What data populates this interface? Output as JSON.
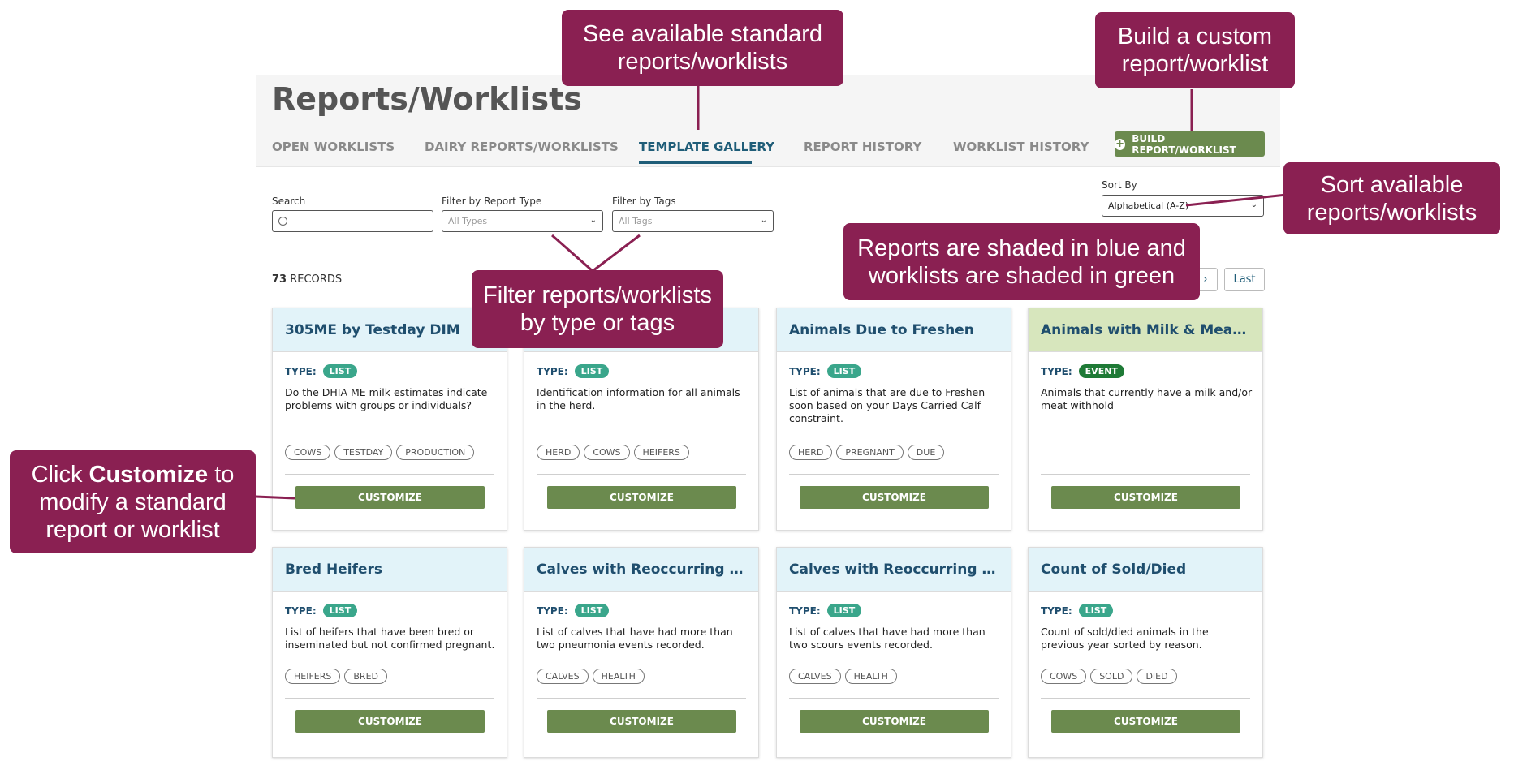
{
  "page_title": "Reports/Worklists",
  "tabs": [
    {
      "label": "OPEN WORKLISTS"
    },
    {
      "label": "DAIRY REPORTS/WORKLISTS"
    },
    {
      "label": "TEMPLATE GALLERY"
    },
    {
      "label": "REPORT HISTORY"
    },
    {
      "label": "WORKLIST HISTORY"
    }
  ],
  "build_button_label": "BUILD REPORT/WORKLIST",
  "filters": {
    "search_label": "Search",
    "report_type_label": "Filter by Report Type",
    "report_type_value": "All Types",
    "tags_label": "Filter by Tags",
    "tags_value": "All Tags",
    "sort_label": "Sort By",
    "sort_value": "Alphabetical (A-Z)"
  },
  "records": {
    "count": "73",
    "label": "RECORDS"
  },
  "pager": {
    "next": "›",
    "last": "Last"
  },
  "type_label": "TYPE:",
  "customize_label": "CUSTOMIZE",
  "cards": [
    {
      "title": "305ME by Testday DIM",
      "type": "LIST",
      "desc": "Do the DHIA ME milk estimates indicate problems with groups or individuals?",
      "tags": [
        "COWS",
        "TESTDAY",
        "PRODUCTION"
      ]
    },
    {
      "title": "",
      "type": "LIST",
      "desc": "Identification information for all animals in the herd.",
      "tags": [
        "HERD",
        "COWS",
        "HEIFERS"
      ]
    },
    {
      "title": "Animals Due to Freshen",
      "type": "LIST",
      "desc": "List of animals that are due to Freshen soon based on your Days Carried Calf constraint.",
      "tags": [
        "HERD",
        "PREGNANT",
        "DUE"
      ]
    },
    {
      "title": "Animals with Milk & Meat Wit...",
      "type": "EVENT",
      "desc": "Animals that currently have a milk and/or meat withhold",
      "tags": []
    },
    {
      "title": "Bred Heifers",
      "type": "LIST",
      "desc": "List of heifers that have been bred or inseminated but not confirmed pregnant.",
      "tags": [
        "HEIFERS",
        "BRED"
      ]
    },
    {
      "title": "Calves with Reoccurring Pneu...",
      "type": "LIST",
      "desc": "List of calves that have had more than two pneumonia events recorded.",
      "tags": [
        "CALVES",
        "HEALTH"
      ]
    },
    {
      "title": "Calves with Reoccurring Scours",
      "type": "LIST",
      "desc": "List of calves that have had more than two scours events recorded.",
      "tags": [
        "CALVES",
        "HEALTH"
      ]
    },
    {
      "title": "Count of Sold/Died",
      "type": "LIST",
      "desc": "Count of sold/died animals in the previous year sorted by reason.",
      "tags": [
        "COWS",
        "SOLD",
        "DIED"
      ]
    }
  ],
  "callouts": {
    "standard": "See available standard reports/worklists",
    "custom": "Build a custom report/worklist",
    "sort": "Sort available reports/worklists",
    "shading": "Reports are shaded in blue and worklists are shaded in green",
    "filter": "Filter reports/worklists by type or tags",
    "customize_pre": "Click ",
    "customize_bold": "Customize",
    "customize_post": " to modify a standard report or worklist"
  },
  "colors": {
    "callout": "#8a2052",
    "button_green": "#6b8a4e",
    "report_shade": "#e2f3f9",
    "worklist_shade": "#d7e6bd",
    "active_tab": "#1f5d78"
  }
}
